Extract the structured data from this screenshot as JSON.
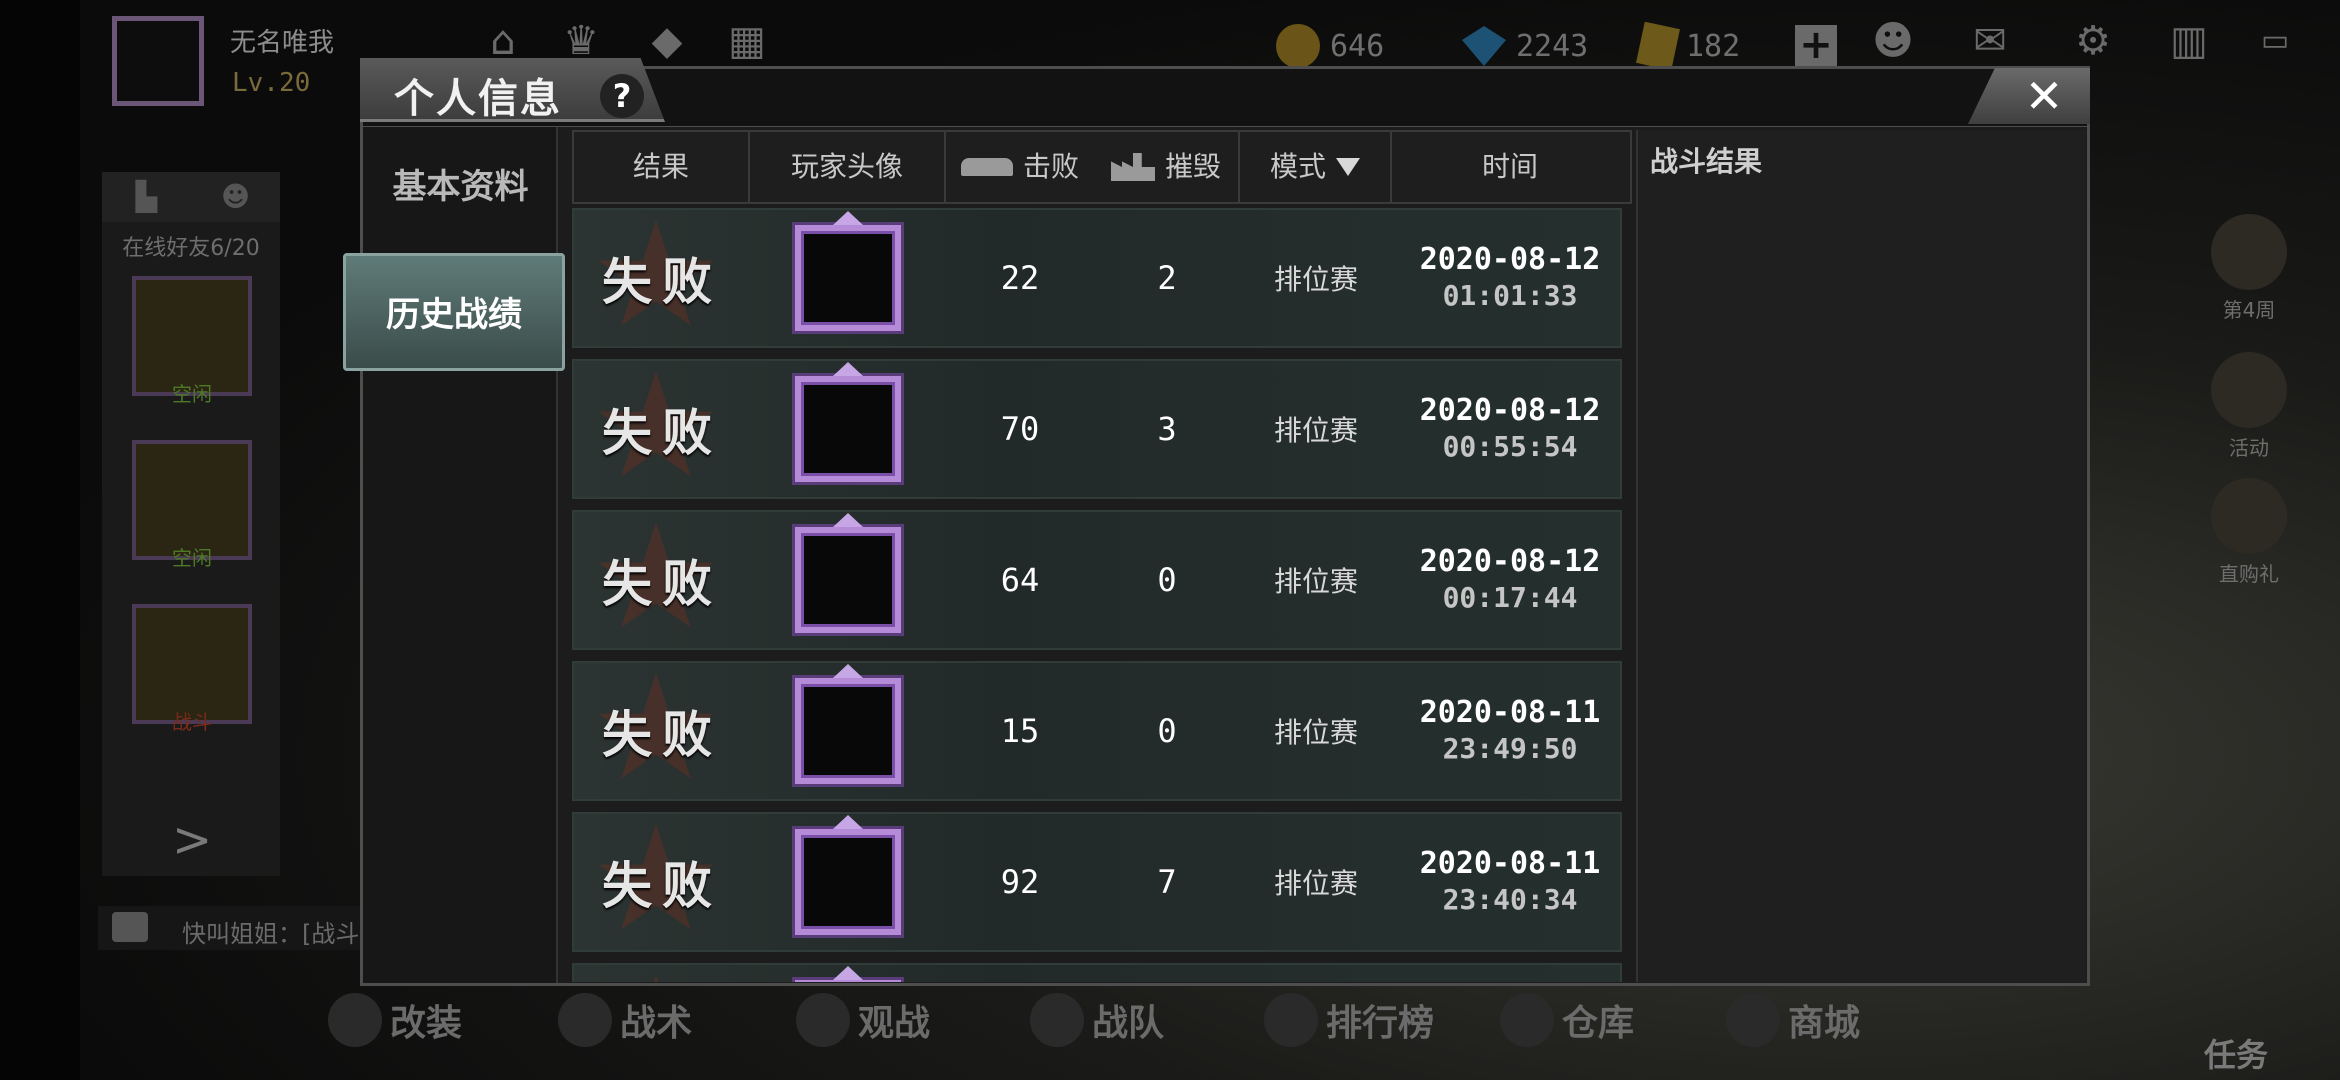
{
  "player": {
    "name": "无名唯我",
    "level": "Lv.20"
  },
  "currencies": [
    {
      "name": "gold",
      "value": "646"
    },
    {
      "name": "diamond",
      "value": "2243"
    },
    {
      "name": "ticket",
      "value": "182"
    }
  ],
  "left_panel": {
    "online_friends": "在线好友6/20",
    "friend_status": [
      "空闲",
      "空闲",
      "战斗"
    ]
  },
  "chat": {
    "preview": "快叫姐姐：[战斗"
  },
  "right_side": [
    {
      "label": "第4周"
    },
    {
      "label": "活动"
    },
    {
      "label": "直购礼"
    }
  ],
  "bottom_nav": [
    {
      "label": "改装"
    },
    {
      "label": "战术"
    },
    {
      "label": "观战"
    },
    {
      "label": "战队"
    },
    {
      "label": "排行榜"
    },
    {
      "label": "仓库"
    },
    {
      "label": "商城"
    }
  ],
  "task_label": "任务",
  "modal": {
    "title": "个人信息",
    "help": "?",
    "close": "✕",
    "tabs": [
      {
        "label": "基本资料",
        "active": false
      },
      {
        "label": "历史战绩",
        "active": true
      }
    ],
    "columns": {
      "result": "结果",
      "avatar": "玩家头像",
      "kills": "击败",
      "destroys": "摧毁",
      "mode": "模式",
      "time": "时间"
    },
    "rows": [
      {
        "result": "失败",
        "kills": "22",
        "destroys": "2",
        "mode": "排位赛",
        "date": "2020-08-12",
        "time": "01:01:33"
      },
      {
        "result": "失败",
        "kills": "70",
        "destroys": "3",
        "mode": "排位赛",
        "date": "2020-08-12",
        "time": "00:55:54"
      },
      {
        "result": "失败",
        "kills": "64",
        "destroys": "0",
        "mode": "排位赛",
        "date": "2020-08-12",
        "time": "00:17:44"
      },
      {
        "result": "失败",
        "kills": "15",
        "destroys": "0",
        "mode": "排位赛",
        "date": "2020-08-11",
        "time": "23:49:50"
      },
      {
        "result": "失败",
        "kills": "92",
        "destroys": "7",
        "mode": "排位赛",
        "date": "2020-08-11",
        "time": "23:40:34"
      }
    ],
    "result_panel_title": "战斗结果"
  }
}
